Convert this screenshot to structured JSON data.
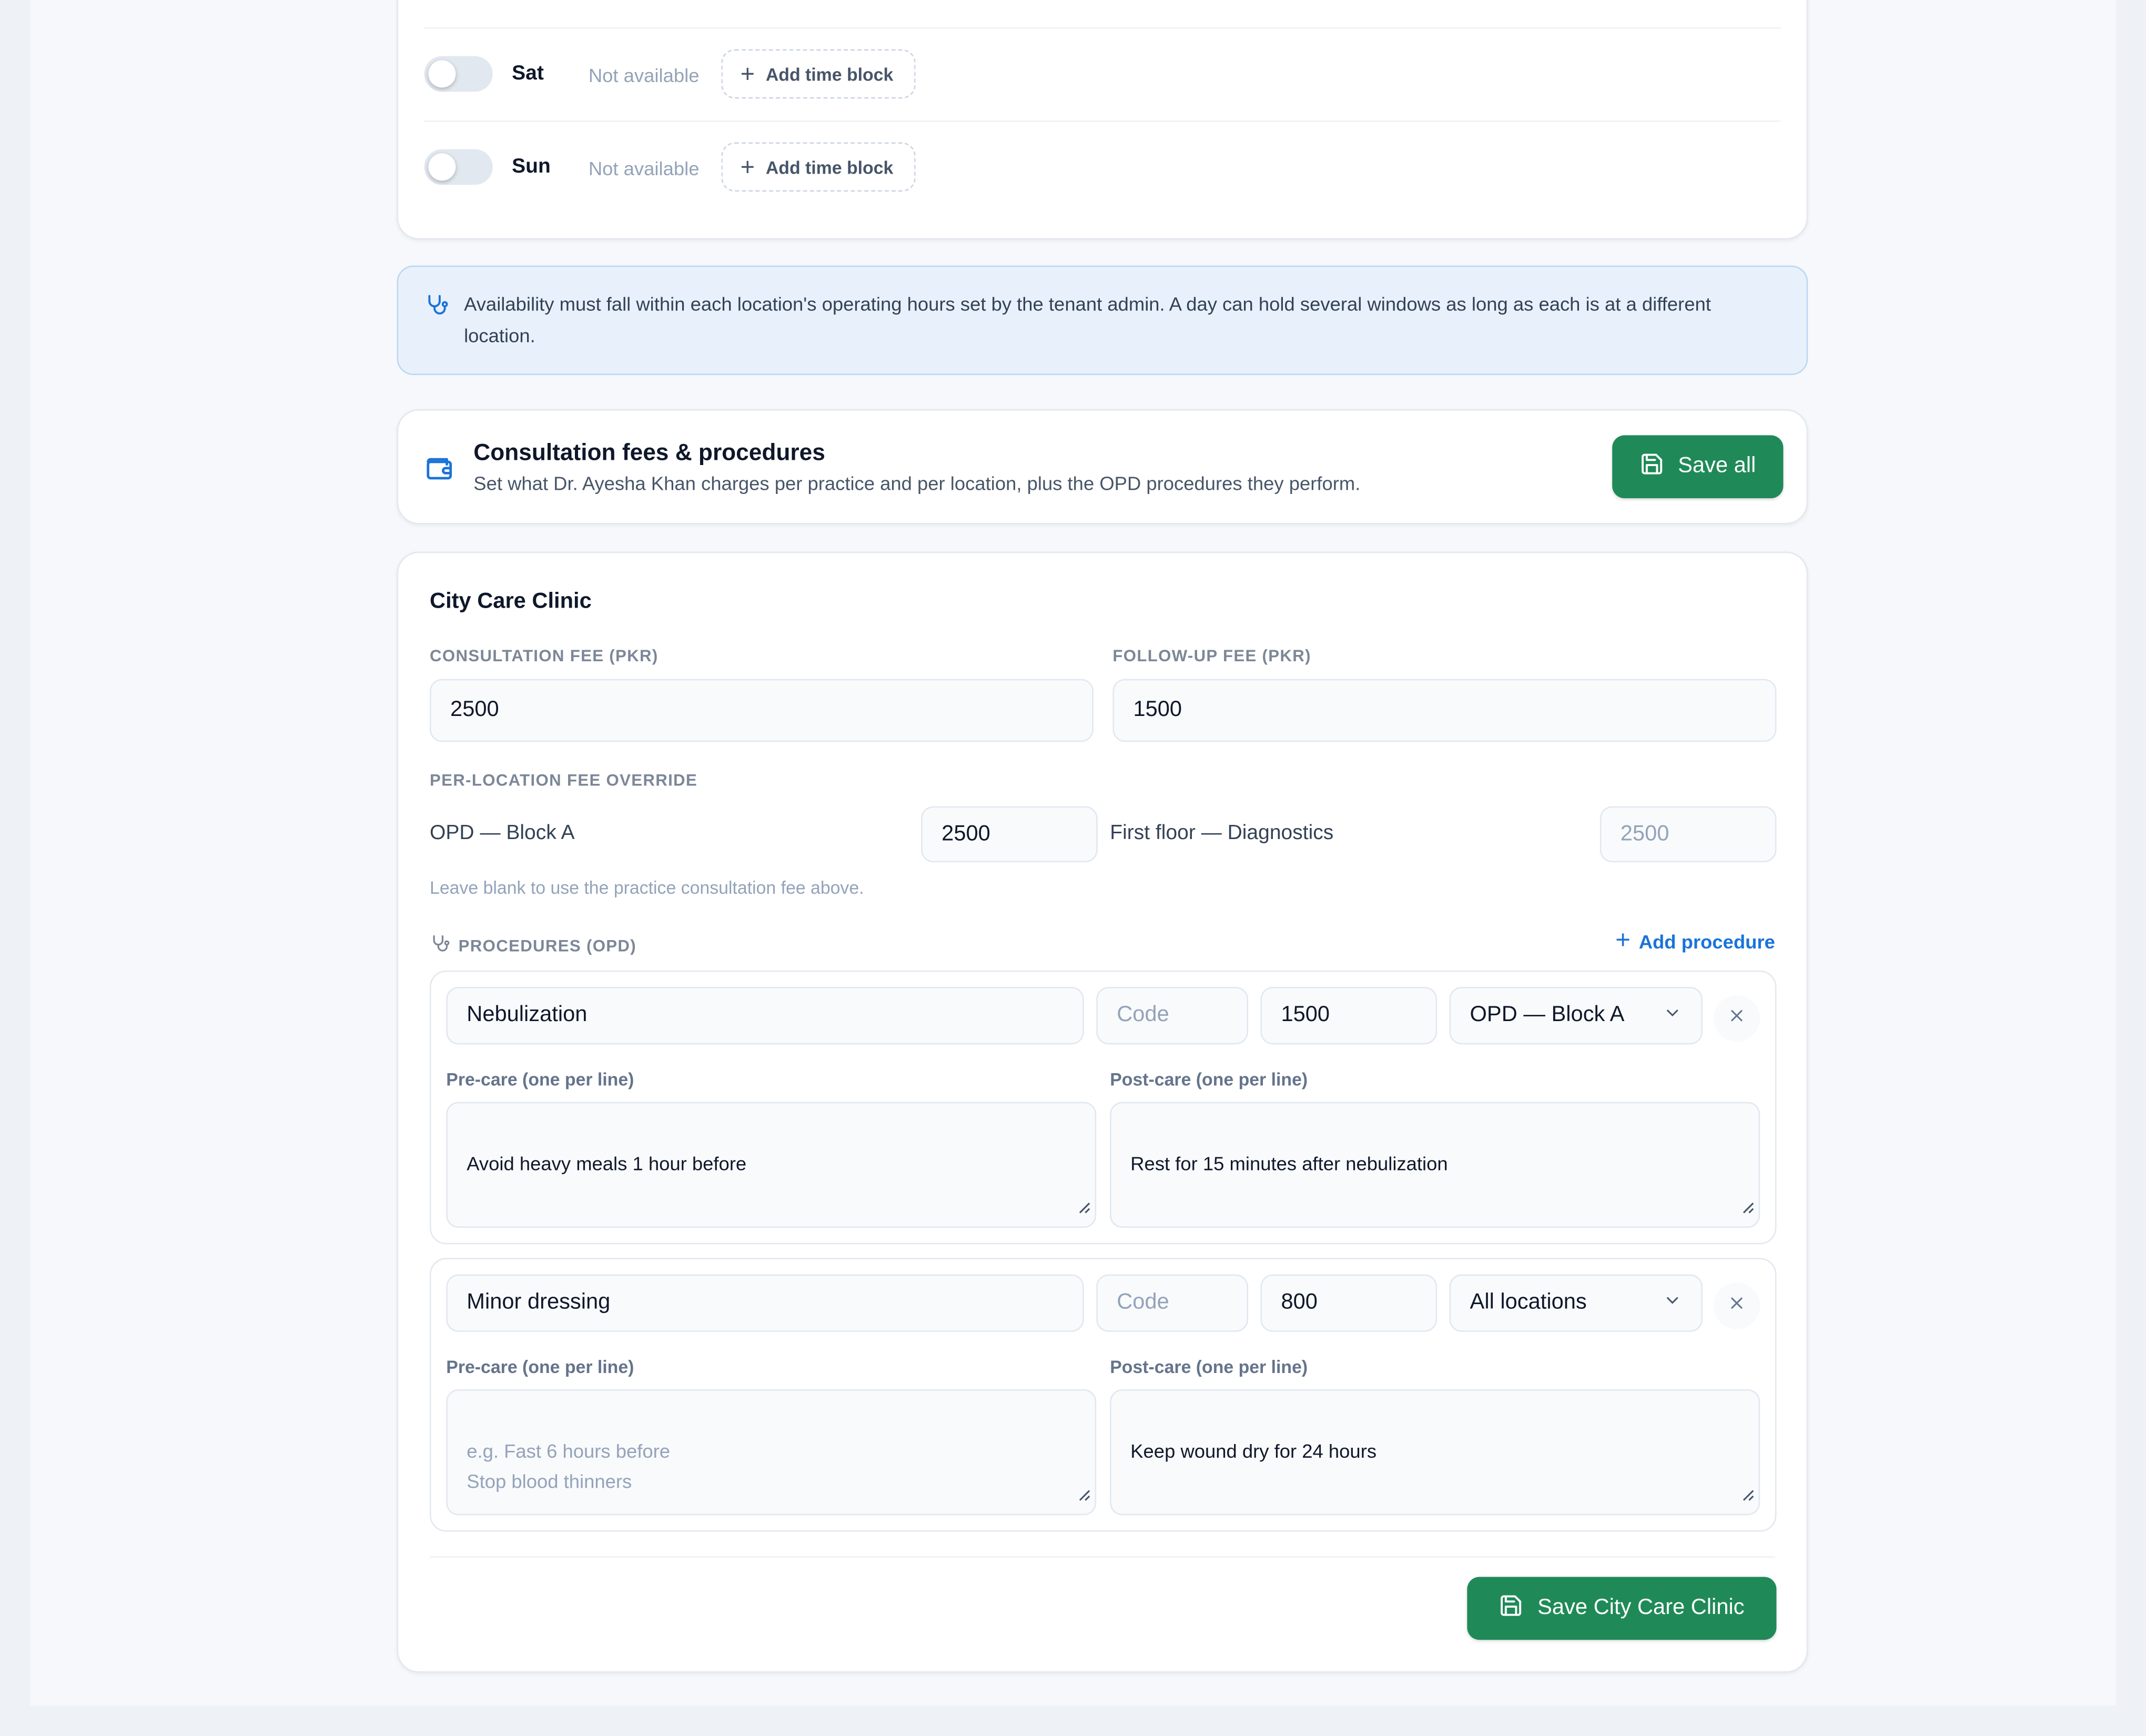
{
  "schedule": {
    "days": [
      {
        "day": "Sat",
        "status": "Not available",
        "add_label": "Add time block"
      },
      {
        "day": "Sun",
        "status": "Not available",
        "add_label": "Add time block"
      }
    ]
  },
  "info_banner": {
    "text": "Availability must fall within each location's operating hours set by the tenant admin. A day can hold several windows as long as each is at a different location."
  },
  "fees_header": {
    "title": "Consultation fees & procedures",
    "subtitle": "Set what Dr. Ayesha Khan charges per practice and per location, plus the OPD procedures they perform.",
    "save_all_label": "Save all"
  },
  "clinic": {
    "name": "City Care Clinic",
    "consultation_fee_label": "CONSULTATION FEE (PKR)",
    "consultation_fee_value": "2500",
    "followup_fee_label": "FOLLOW-UP FEE (PKR)",
    "followup_fee_value": "1500",
    "override_label": "PER-LOCATION FEE OVERRIDE",
    "locations": [
      {
        "name": "OPD — Block A",
        "value": "2500",
        "placeholder": ""
      },
      {
        "name": "First floor — Diagnostics",
        "value": "",
        "placeholder": "2500"
      }
    ],
    "override_hint": "Leave blank to use the practice consultation fee above.",
    "procedures_label": "PROCEDURES (OPD)",
    "add_procedure_label": "Add procedure",
    "procedures": [
      {
        "name": "Nebulization",
        "code_placeholder": "Code",
        "price": "1500",
        "location": "OPD — Block A",
        "pre_care_label": "Pre-care (one per line)",
        "pre_care_value": "Avoid heavy meals 1 hour before",
        "pre_care_placeholder": "",
        "post_care_label": "Post-care (one per line)",
        "post_care_value": "Rest for 15 minutes after nebulization"
      },
      {
        "name": "Minor dressing",
        "code_placeholder": "Code",
        "price": "800",
        "location": "All locations",
        "pre_care_label": "Pre-care (one per line)",
        "pre_care_value": "",
        "pre_care_placeholder": "e.g. Fast 6 hours before\nStop blood thinners",
        "post_care_label": "Post-care (one per line)",
        "post_care_value": "Keep wound dry for 24 hours"
      }
    ],
    "save_label": "Save City Care Clinic"
  },
  "colors": {
    "accent_green": "#1f8a58",
    "link_blue": "#1a73d9",
    "info_bg": "#e8f1fb"
  }
}
